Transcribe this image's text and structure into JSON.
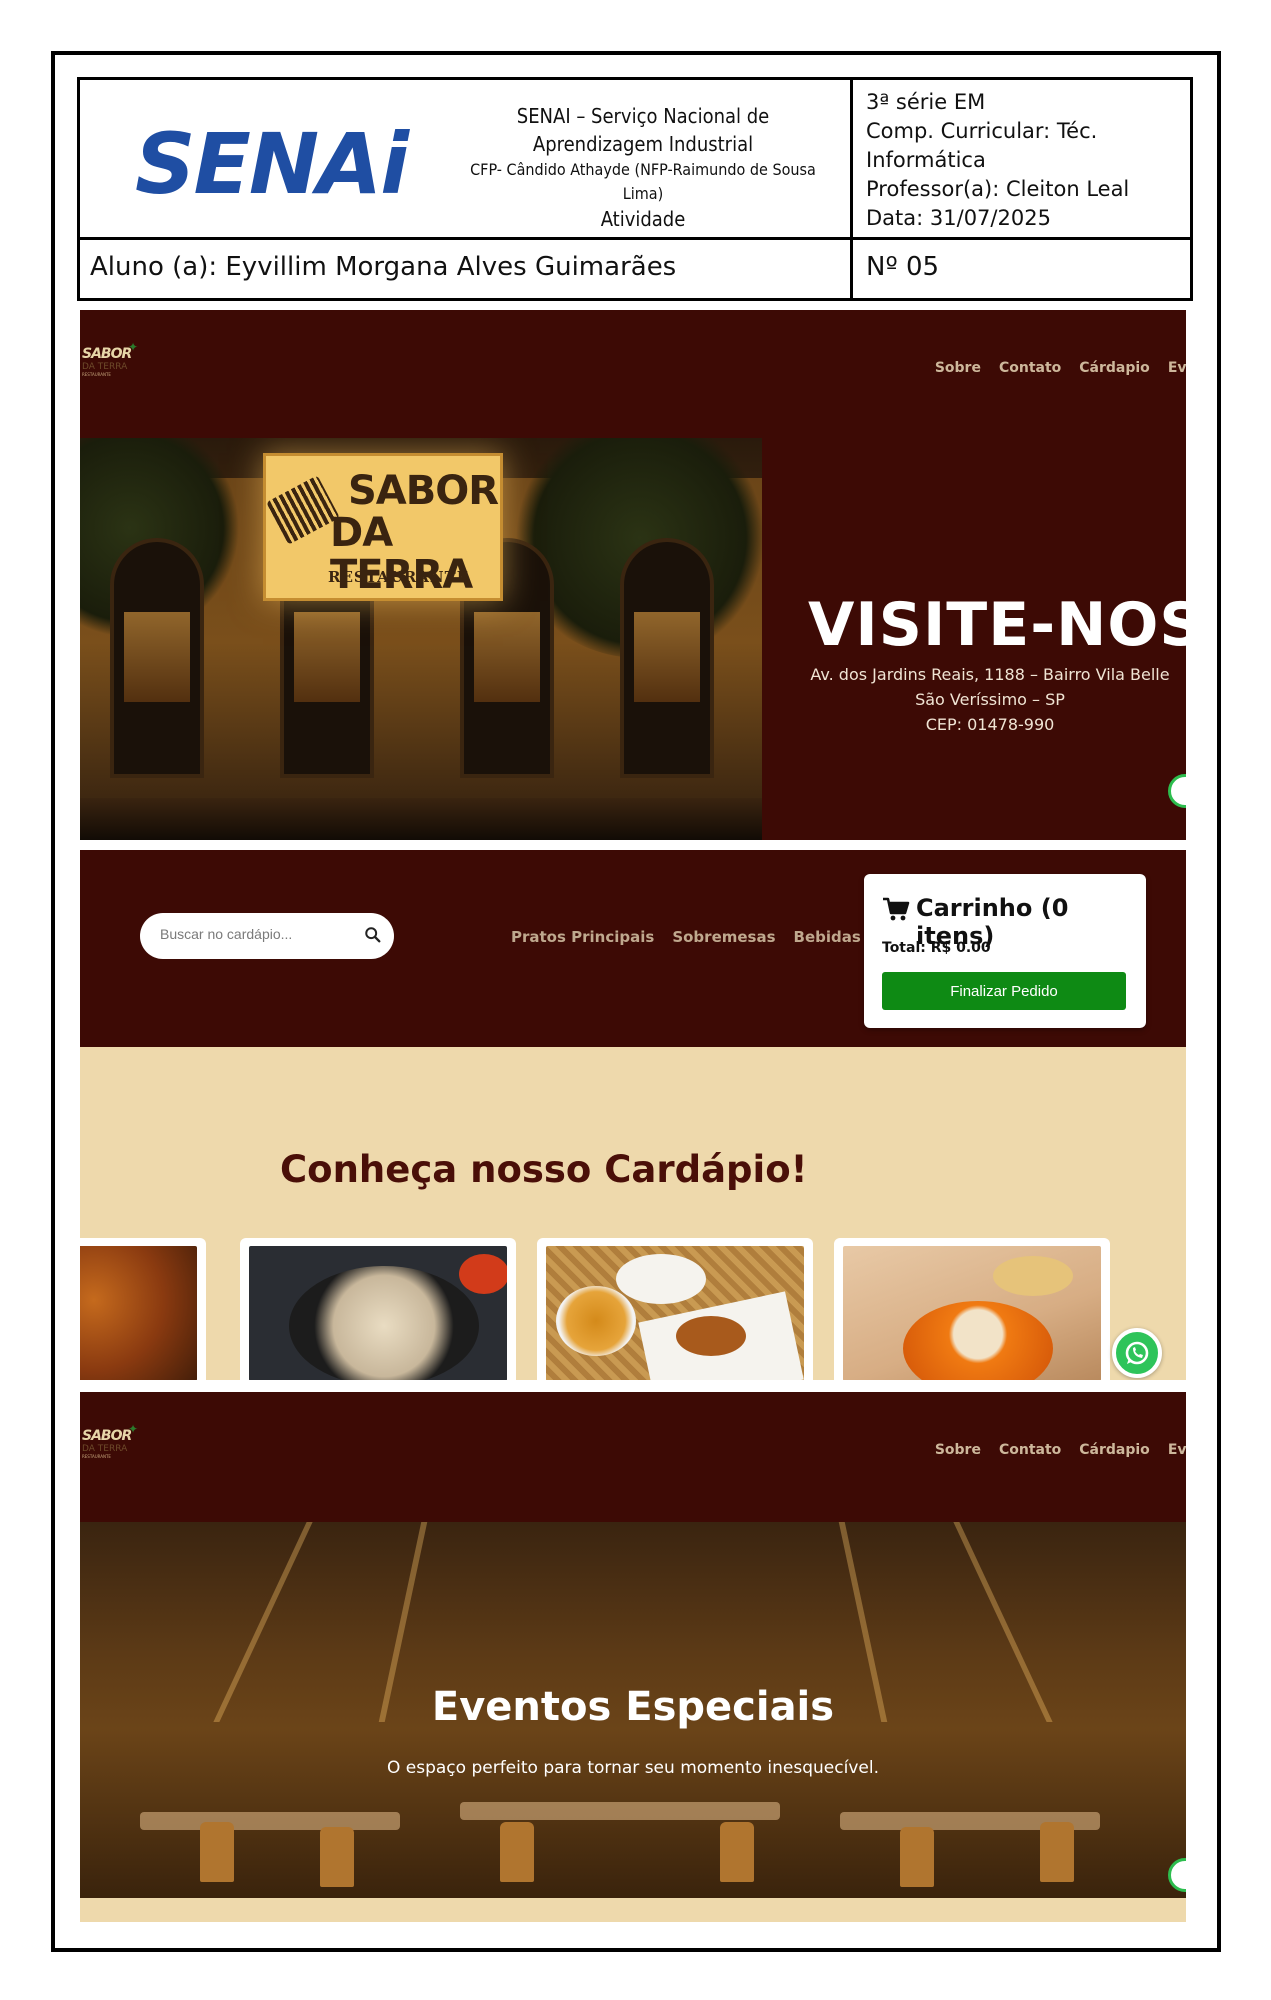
{
  "header": {
    "logo_text": "SENAi",
    "institution_line1": "SENAI – Serviço Nacional de",
    "institution_line2": "Aprendizagem Industrial",
    "institution_line3": "CFP- Cândido Athayde (NFP-Raimundo de Sousa",
    "institution_line4": "Lima)",
    "institution_line5": "Atividade",
    "grade": "3ª série EM",
    "curricular_component": "Comp. Curricular: Téc.",
    "curricular_component_2": "Informática",
    "teacher": "Professor(a): Cleiton Leal",
    "date": "Data: 31/07/2025",
    "student": "Aluno (a): Eyvillim Morgana Alves Guimarães",
    "number": "Nº 05"
  },
  "site": {
    "logo_line1": "SABOR",
    "logo_line2": "DA TERRA",
    "logo_line3": "RESTAURANTE",
    "nav": [
      "Sobre",
      "Contato",
      "Cárdapio",
      "Eve"
    ],
    "colors": {
      "primary": "#3d0a05",
      "cream": "#eed9ac",
      "green_button": "#0e8a14",
      "whatsapp": "#2ec45a"
    }
  },
  "screen1": {
    "sign_line1": "SABOR",
    "sign_line2": "DA TERRA",
    "sign_line3": "RESTAURANTE",
    "title": "VISITE-NOS",
    "address_line1": "Av. dos Jardins Reais, 1188 – Bairro Vila Belle",
    "address_line2": "São Veríssimo – SP",
    "address_line3": "CEP: 01478-990"
  },
  "screen2": {
    "search_placeholder": "Buscar no cardápio...",
    "categories": [
      "Pratos Principais",
      "Sobremesas",
      "Bebidas"
    ],
    "cart_title": "Carrinho (0 itens)",
    "cart_total": "Total: R$ 0.00",
    "cart_button": "Finalizar Pedido",
    "menu_title": "Conheça nosso Cardápio!"
  },
  "screen3": {
    "nav": [
      "Sobre",
      "Contato",
      "Cárdapio",
      "Eve"
    ],
    "title": "Eventos Especiais",
    "subtitle": "O espaço perfeito para tornar seu momento inesquecível."
  }
}
